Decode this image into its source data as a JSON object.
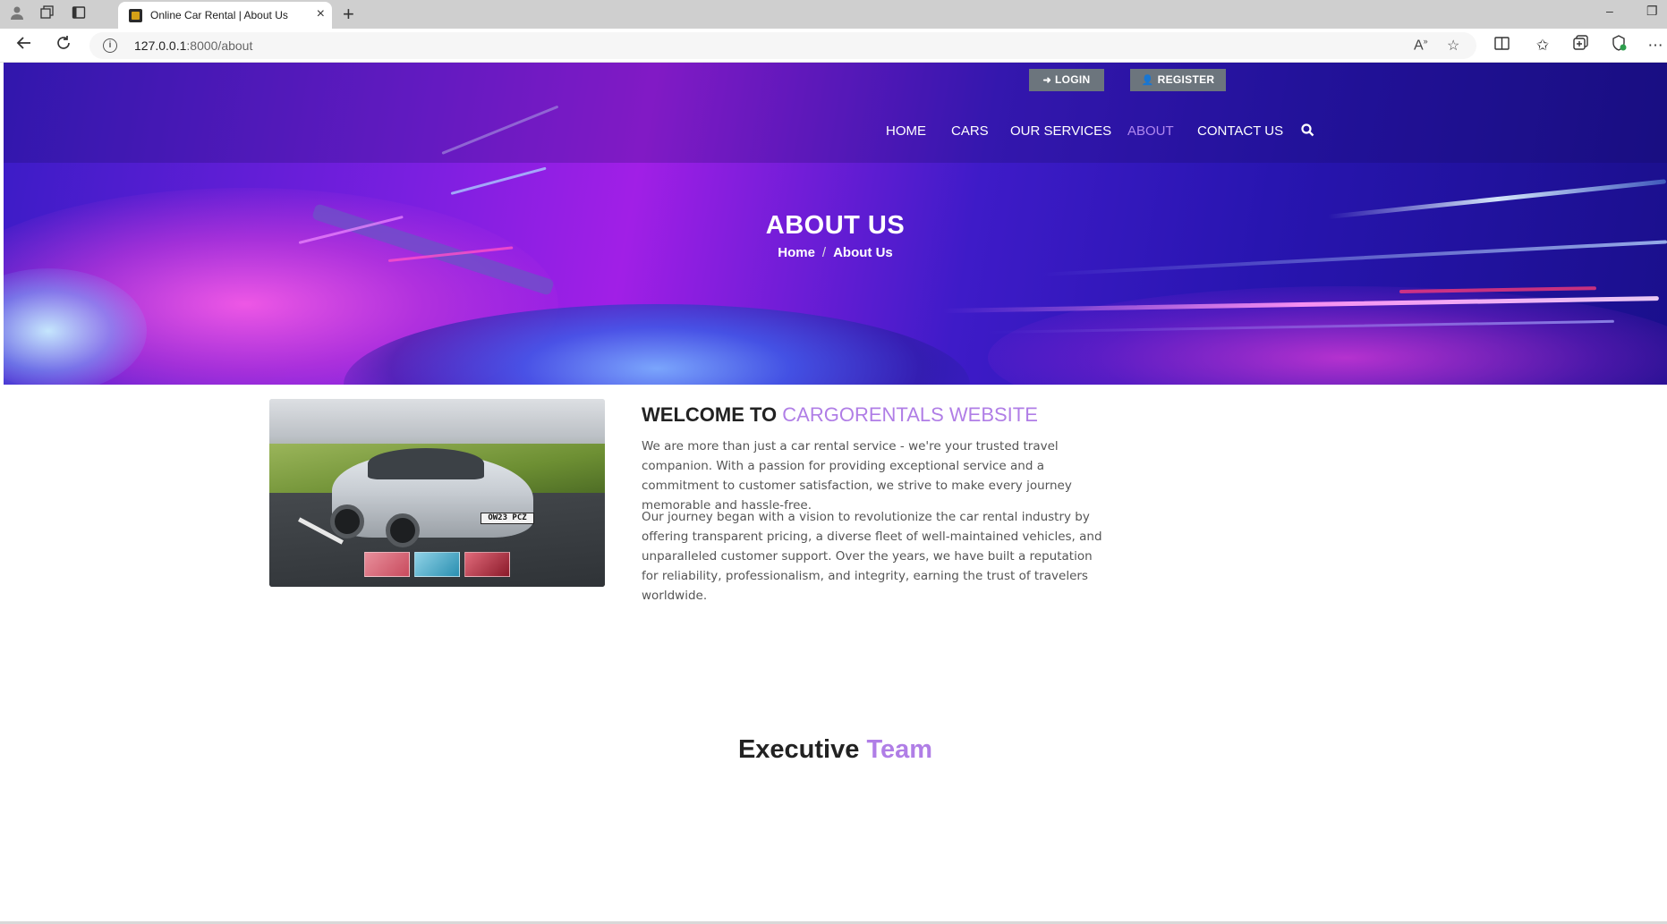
{
  "browser": {
    "tab_title": "Online Car Rental | About Us",
    "url_host": "127.0.0.1",
    "url_rest": ":8000/about"
  },
  "header": {
    "login_label": "LOGIN",
    "register_label": "REGISTER",
    "nav": [
      {
        "label": "HOME",
        "active": false
      },
      {
        "label": "CARS",
        "active": false
      },
      {
        "label": "OUR SERVICES",
        "active": false
      },
      {
        "label": "ABOUT",
        "active": true
      },
      {
        "label": "CONTACT US",
        "active": false
      }
    ]
  },
  "hero": {
    "title": "ABOUT US",
    "breadcrumb_home": "Home",
    "breadcrumb_sep": "/",
    "breadcrumb_current": "About Us"
  },
  "welcome": {
    "heading_prefix": "WELCOME TO ",
    "heading_accent": "CARGORENTALS WEBSITE",
    "plate_text": "OW23 PCZ",
    "paragraph_1": "We are more than just a car rental service - we're your trusted travel companion. With a passion for providing exceptional service and a commitment to customer satisfaction, we strive to make every journey memorable and hassle-free.",
    "paragraph_2": "Our journey began with a vision to revolutionize the car rental industry by offering transparent pricing, a diverse fleet of well-maintained vehicles, and unparalleled customer support. Over the years, we have built a reputation for reliability, professionalism, and integrity, earning the trust of travelers worldwide."
  },
  "team": {
    "heading_prefix": "Executive ",
    "heading_accent": "Team"
  },
  "colors": {
    "accent": "#b07ee6",
    "nav_active": "#b088f0",
    "auth_button": "#6c757d"
  }
}
